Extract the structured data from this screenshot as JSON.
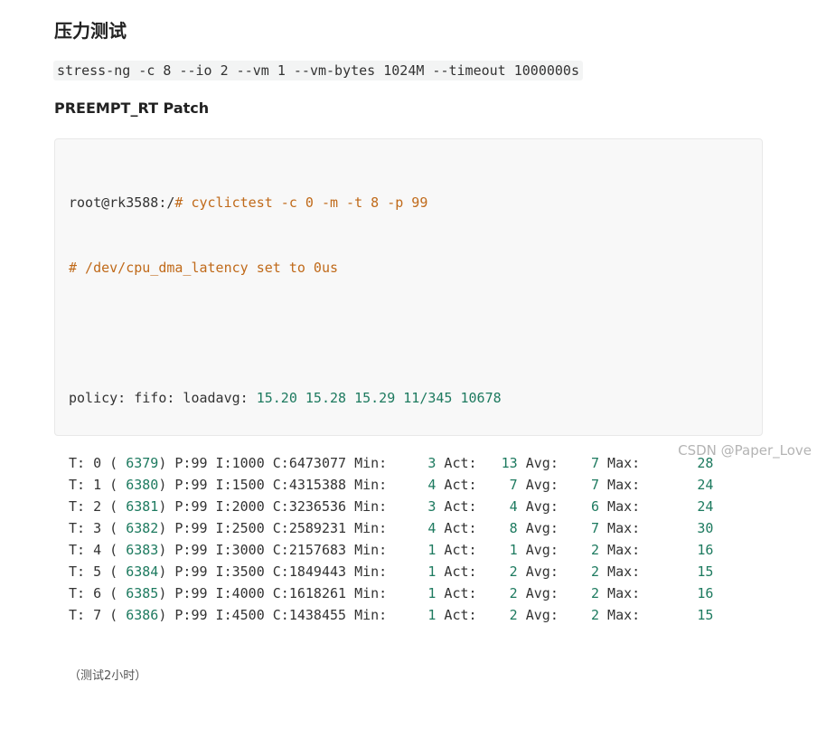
{
  "heading": "压力测试",
  "stress_command": "stress-ng -c 8 --io 2 --vm 1 --vm-bytes 1024M --timeout 1000000s",
  "subheading": "PREEMPT_RT Patch",
  "code": {
    "prompt": "root@rk3588:/",
    "command": "# cyclictest -c 0 -m -t 8 -p 99",
    "comment": "# /dev/cpu_dma_latency set to 0us",
    "policy_prefix": "policy: fifo: loadavg: ",
    "loadavg": "15.20 15.28 15.29 11/345 10678",
    "threads": [
      {
        "t": "T: 0",
        "pid": " 6379",
        "rest": " P:99 I:1000 C:6473077 Min:",
        "min": "3",
        "act": "13",
        "avg": "7",
        "max": "28"
      },
      {
        "t": "T: 1",
        "pid": " 6380",
        "rest": " P:99 I:1500 C:4315388 Min:",
        "min": "4",
        "act": "7",
        "avg": "7",
        "max": "24"
      },
      {
        "t": "T: 2",
        "pid": " 6381",
        "rest": " P:99 I:2000 C:3236536 Min:",
        "min": "3",
        "act": "4",
        "avg": "6",
        "max": "24"
      },
      {
        "t": "T: 3",
        "pid": " 6382",
        "rest": " P:99 I:2500 C:2589231 Min:",
        "min": "4",
        "act": "8",
        "avg": "7",
        "max": "30"
      },
      {
        "t": "T: 4",
        "pid": " 6383",
        "rest": " P:99 I:3000 C:2157683 Min:",
        "min": "1",
        "act": "1",
        "avg": "2",
        "max": "16"
      },
      {
        "t": "T: 5",
        "pid": " 6384",
        "rest": " P:99 I:3500 C:1849443 Min:",
        "min": "1",
        "act": "2",
        "avg": "2",
        "max": "15"
      },
      {
        "t": "T: 6",
        "pid": " 6385",
        "rest": " P:99 I:4000 C:1618261 Min:",
        "min": "1",
        "act": "2",
        "avg": "2",
        "max": "16"
      },
      {
        "t": "T: 7",
        "pid": " 6386",
        "rest": " P:99 I:4500 C:1438455 Min:",
        "min": "1",
        "act": "2",
        "avg": "2",
        "max": "15"
      }
    ],
    "note": "（测试2小时）"
  },
  "watermark": "CSDN @Paper_Love",
  "colors": {
    "orange": "#c06a1a",
    "number": "#1d7a5f",
    "code_bg": "#f8f8f8"
  }
}
